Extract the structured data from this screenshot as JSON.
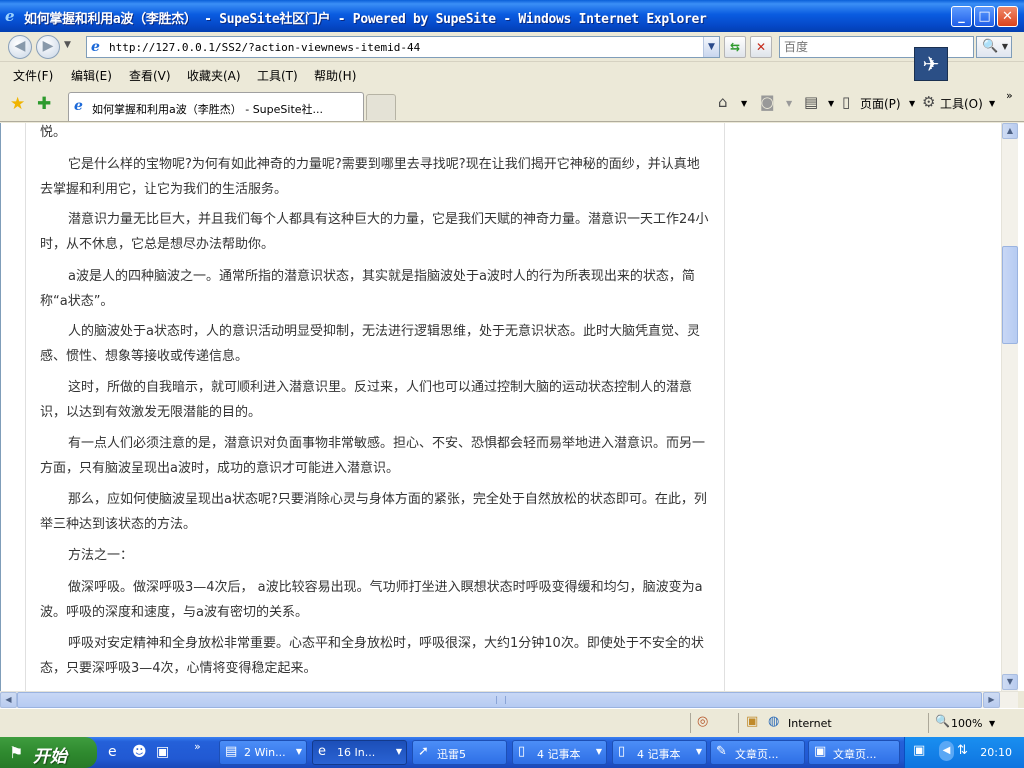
{
  "window": {
    "title": "如何掌握和利用a波（李胜杰） - SupeSite社区门户 - Powered by SupeSite - Windows Internet Explorer",
    "minimize_glyph": "_",
    "maximize_glyph": "□",
    "close_glyph": "✕"
  },
  "address_bar": {
    "url": "http://127.0.0.1/SS2/?action-viewnews-itemid-44",
    "search_placeholder": "百度"
  },
  "menu": [
    "文件(F)",
    "编辑(E)",
    "查看(V)",
    "收藏夹(A)",
    "工具(T)",
    "帮助(H)"
  ],
  "tab": {
    "label": "如何掌握和利用a波（李胜杰） - SupeSite社..."
  },
  "commands": {
    "page": "页面(P)",
    "tools": "工具(O)"
  },
  "article": {
    "paragraphs": [
      "悦。",
      "它是什么样的宝物呢?为何有如此神奇的力量呢?需要到哪里去寻找呢?现在让我们揭开它神秘的面纱，并认真地去掌握和利用它，让它为我们的生活服务。",
      "潜意识力量无比巨大，并且我们每个人都具有这种巨大的力量，它是我们天赋的神奇力量。潜意识一天工作24小时，从不休息，它总是想尽办法帮助你。",
      "a波是人的四种脑波之一。通常所指的潜意识状态，其实就是指脑波处于a波时人的行为所表现出来的状态，简称“a状态”。",
      "人的脑波处于a状态时，人的意识活动明显受抑制，无法进行逻辑思维，处于无意识状态。此时大脑凭直觉、灵感、惯性、想象等接收或传递信息。",
      "这时，所做的自我暗示，就可顺利进入潜意识里。反过来，人们也可以通过控制大脑的运动状态控制人的潜意识，以达到有效激发无限潜能的目的。",
      "有一点人们必须注意的是，潜意识对负面事物非常敏感。担心、不安、恐惧都会轻而易举地进入潜意识。而另一方面，只有脑波呈现出a波时，成功的意识才可能进入潜意识。",
      "那么，应如何使脑波呈现出a状态呢?只要消除心灵与身体方面的紧张，完全处于自然放松的状态即可。在此，列举三种达到该状态的方法。",
      "方法之一：",
      "做深呼吸。做深呼吸3—4次后， a波比较容易出现。气功师打坐进入瞑想状态时呼吸变得缓和均匀，脑波变为a波。呼吸的深度和速度，与a波有密切的关系。",
      "呼吸对安定精神和全身放松非常重要。心态平和全身放松时，呼吸很深，大约1分钟10次。即使处于不安全的状态，只要深呼吸3—4次，心情将变得稳定起来。"
    ]
  },
  "status": {
    "zone": "Internet",
    "zoom": "100%"
  },
  "taskbar": {
    "start": "开始",
    "tasks": [
      {
        "icon": "explorer-icon",
        "label": "2 Win..."
      },
      {
        "icon": "ie-icon",
        "label": "16 In..."
      },
      {
        "icon": "thunder-icon",
        "label": "迅雷5"
      },
      {
        "icon": "notepad-icon",
        "label": "4 记事本"
      },
      {
        "icon": "notepad-icon",
        "label": "4 记事本"
      },
      {
        "icon": "pen-icon",
        "label": "文章页..."
      },
      {
        "icon": "app-icon",
        "label": "文章页..."
      }
    ],
    "clock": "20:10"
  }
}
